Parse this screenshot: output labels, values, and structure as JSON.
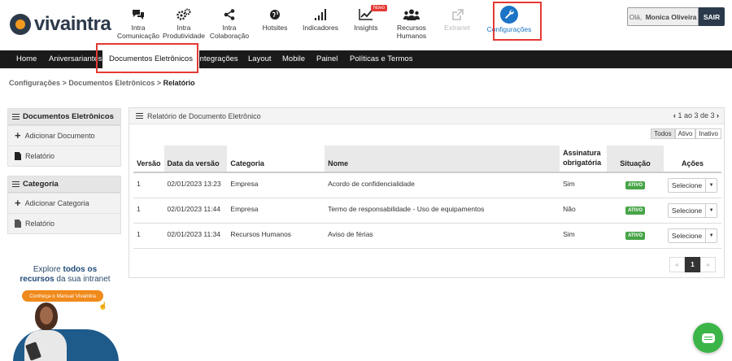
{
  "app": {
    "logo_text": "vivaintra"
  },
  "nav": [
    {
      "label": "Intra\nComunicação",
      "icon": "chat-bubbles-icon"
    },
    {
      "label": "Intra\nProdutividade",
      "icon": "gears-icon"
    },
    {
      "label": "Intra\nColaboração",
      "icon": "share-icon"
    },
    {
      "label": "Hotsites",
      "icon": "globe-icon"
    },
    {
      "label": "Indicadores",
      "icon": "signal-bars-icon"
    },
    {
      "label": "Insights",
      "icon": "line-chart-icon",
      "badge": "Novo"
    },
    {
      "label": "Recursos\nHumanos",
      "icon": "users-icon"
    },
    {
      "label": "Extranet",
      "icon": "external-link-icon",
      "disabled": true
    },
    {
      "label": "Configurações",
      "icon": "wrench-icon",
      "active": true
    }
  ],
  "user": {
    "greeting": "Olá,",
    "name": "Monica Oliveira",
    "logout_label": "SAIR"
  },
  "menu": [
    "Home",
    "Aniversariantes",
    "Documentos Eletrônicos",
    "Integrações",
    "Layout",
    "Mobile",
    "Painel",
    "Políticas e Termos"
  ],
  "menu_active_index": 2,
  "breadcrumb": {
    "part1": "Configurações",
    "sep": ">",
    "part2": "Documentos Eletrônicos",
    "current": "Relatório"
  },
  "sidebar": {
    "docs": {
      "title": "Documentos Eletrônicos",
      "items": [
        "Adicionar Documento",
        "Relatório"
      ]
    },
    "category": {
      "title": "Categoria",
      "items": [
        "Adicionar Categoria",
        "Relatório"
      ]
    }
  },
  "promo": {
    "line1_a": "Explore",
    "line1_b": "todos os",
    "line2_a": "recursos",
    "line2_b": "da sua intranet",
    "button": "Conheça o Manual Vivaintra"
  },
  "report": {
    "title": "Relatório de Documento Eletrônico",
    "pager": "1 ao 3 de 3",
    "filters": [
      "Todos",
      "Ativo",
      "Inativo"
    ],
    "columns": [
      "Versão",
      "Data da versão",
      "Categoria",
      "Nome",
      "Assinatura obrigatória",
      "Situação",
      "Ações"
    ],
    "rows": [
      {
        "versao": "1",
        "data": "02/01/2023 13:23",
        "categoria": "Empresa",
        "nome": "Acordo de confidencialidade",
        "assinatura": "Sim",
        "situacao": "ATIVO",
        "acao": "Selecione"
      },
      {
        "versao": "1",
        "data": "02/01/2023 11:44",
        "categoria": "Empresa",
        "nome": "Termo de responsabilidade - Uso de equipamentos",
        "assinatura": "Não",
        "situacao": "ATIVO",
        "acao": "Selecione"
      },
      {
        "versao": "1",
        "data": "02/01/2023 11:34",
        "categoria": "Recursos Humanos",
        "nome": "Aviso de férias",
        "assinatura": "Sim",
        "situacao": "ATIVO",
        "acao": "Selecione"
      }
    ],
    "pagination": {
      "prev": "«",
      "current": "1",
      "next": "»"
    }
  },
  "colors": {
    "accent": "#1b74c5",
    "highlight": "#e53935",
    "menubar": "#1a1a1a",
    "status_active": "#47a447",
    "chat": "#3bb547",
    "promo_button": "#f08a1c"
  }
}
